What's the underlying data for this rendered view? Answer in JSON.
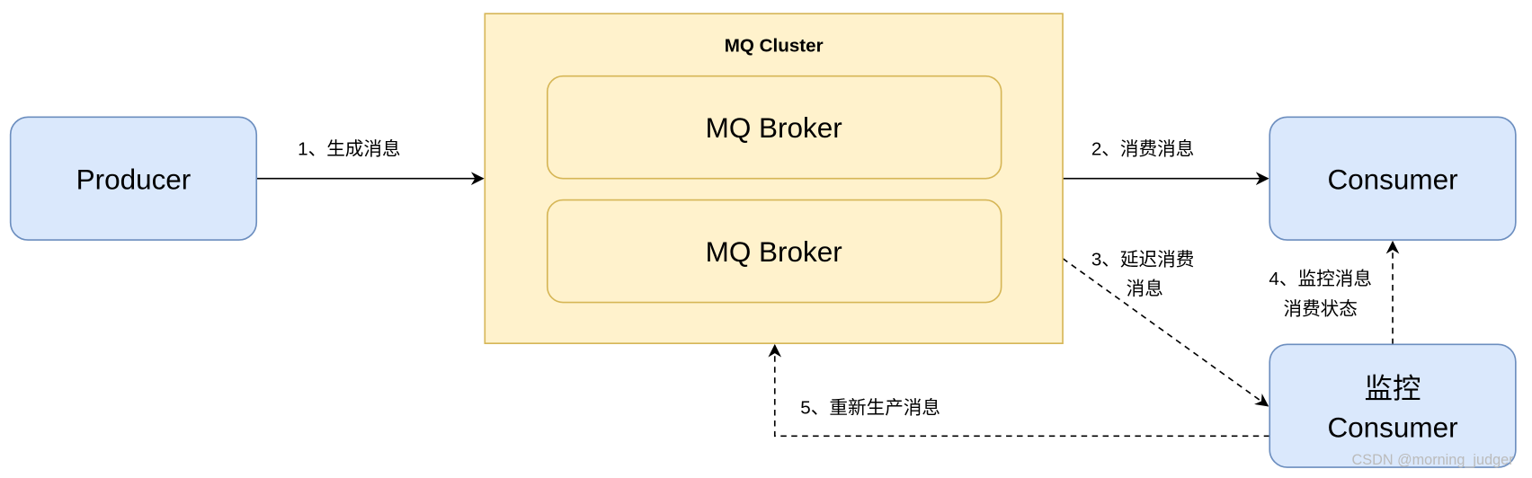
{
  "colors": {
    "node_fill": "#dae8fc",
    "node_stroke": "#6c8ebf",
    "cluster_fill": "#fff2cc",
    "cluster_stroke": "#d6b656"
  },
  "nodes": {
    "producer": "Producer",
    "cluster_title": "MQ Cluster",
    "broker1": "MQ Broker",
    "broker2": "MQ Broker",
    "consumer": "Consumer",
    "monitor_line1": "监控",
    "monitor_line2": "Consumer"
  },
  "edges": {
    "e1": "1、生成消息",
    "e2": "2、消费消息",
    "e3_line1": "3、延迟消费",
    "e3_line2": "消息",
    "e4_line1": "4、监控消息",
    "e4_line2": "消费状态",
    "e5": "5、重新生产消息"
  },
  "watermark": "CSDN @morning_judger"
}
